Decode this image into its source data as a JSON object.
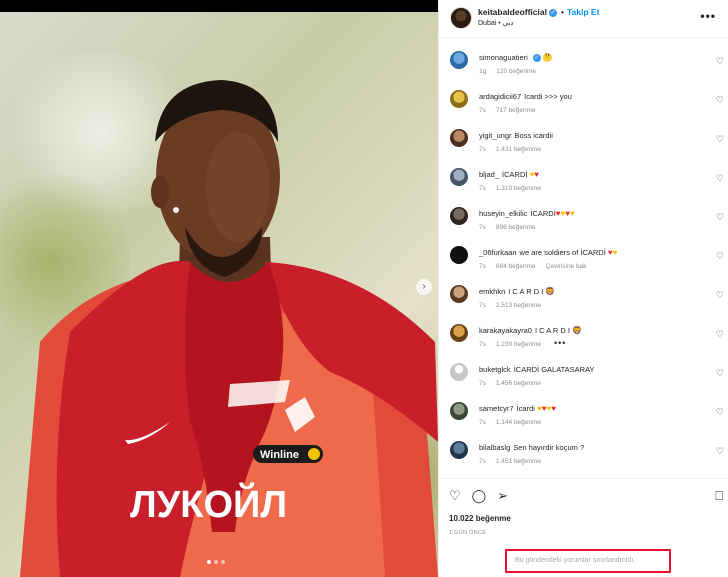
{
  "post": {
    "username": "keitabaldeofficial",
    "follow_label": "Takip Et",
    "location": "Dubai • دبي",
    "more_label": "•••",
    "media_text": "ЛУКОЙЛ",
    "media_sponsor": "Winline"
  },
  "comments": [
    {
      "user": "simonaguatieri",
      "text": "",
      "verified": true,
      "time": "1g",
      "likes": "120 beğenme",
      "translate": ""
    },
    {
      "user": "ardagidicii67",
      "text": "Icardi >>> you",
      "time": "7s",
      "likes": "717 beğenme",
      "translate": ""
    },
    {
      "user": "yigit_ungr",
      "text": "Boss icardii",
      "time": "7s",
      "likes": "1.431 beğenme",
      "translate": ""
    },
    {
      "user": "bljad_",
      "text": "İCARDİ",
      "time": "7s",
      "likes": "1.319 beğenme",
      "translate": ""
    },
    {
      "user": "huseyin_elkilic",
      "text": "İCARDİ",
      "time": "7s",
      "likes": "896 beğenme",
      "translate": ""
    },
    {
      "user": "_06furkaan",
      "text": "we are soldiers of İCARDİ",
      "time": "7s",
      "likes": "684 beğenme",
      "translate": "Çevirisine bak"
    },
    {
      "user": "emkhkn",
      "text": "I C A R D I",
      "time": "7s",
      "likes": "2.513 beğenme",
      "translate": ""
    },
    {
      "user": "karakayakayra0",
      "text": "I C A R D I",
      "time": "7s",
      "likes": "1.239 beğenme",
      "translate": ""
    },
    {
      "user": "buketglck",
      "text": "İCARDİ GALATASARAY",
      "time": "7s",
      "likes": "1.456 beğenme",
      "translate": ""
    },
    {
      "user": "sametcyr7",
      "text": "İcardi",
      "time": "7s",
      "likes": "1.144 beğenme",
      "translate": ""
    },
    {
      "user": "bilalbaslg",
      "text": "Sen hayırdir koçum ?",
      "time": "7s",
      "likes": "1.451 beğenme",
      "translate": ""
    }
  ],
  "footer": {
    "likes": "10.022 beğenme",
    "time": "1 GÜN ÖNCE",
    "comments_limited": "Bu gönderideki yorumlar sınırlandırıldı."
  },
  "colors": {
    "accent": "#0095f6",
    "highlight_box": "#e8132d",
    "kit_red": "#e3262e"
  },
  "icons": [
    "heart-icon",
    "comment-icon",
    "share-icon",
    "bookmark-icon",
    "verified-icon",
    "chevron-right-icon"
  ]
}
